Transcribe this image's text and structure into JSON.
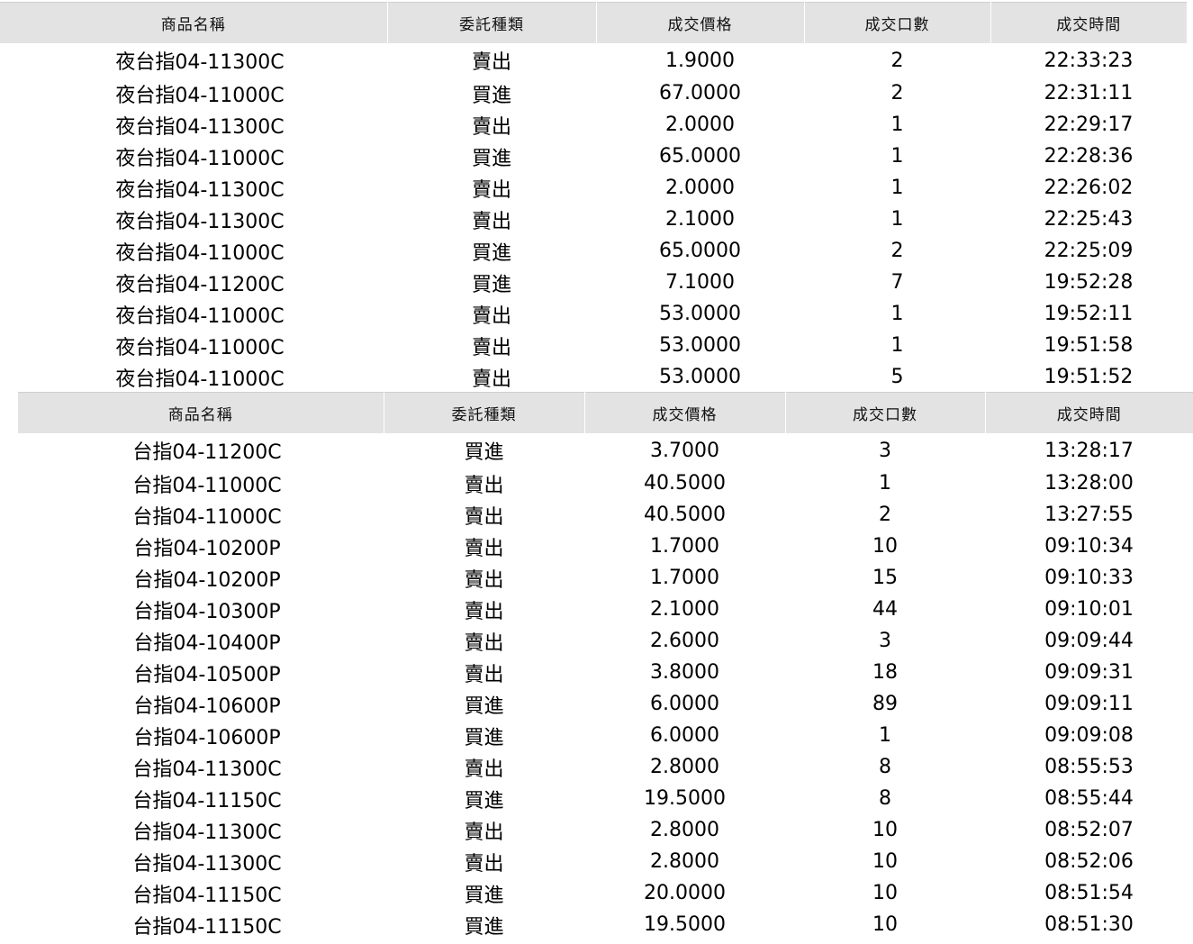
{
  "night_session": {
    "headers": [
      "商品名稱",
      "委託種類",
      "成交價格",
      "成交口數",
      "成交時間"
    ],
    "rows": [
      [
        "夜台指04-11300C",
        "賣出",
        "1.9000",
        "2",
        "22:33:23"
      ],
      [
        "夜台指04-11000C",
        "買進",
        "67.0000",
        "2",
        "22:31:11"
      ],
      [
        "夜台指04-11300C",
        "賣出",
        "2.0000",
        "1",
        "22:29:17"
      ],
      [
        "夜台指04-11000C",
        "買進",
        "65.0000",
        "1",
        "22:28:36"
      ],
      [
        "夜台指04-11300C",
        "賣出",
        "2.0000",
        "1",
        "22:26:02"
      ],
      [
        "夜台指04-11300C",
        "賣出",
        "2.1000",
        "1",
        "22:25:43"
      ],
      [
        "夜台指04-11000C",
        "買進",
        "65.0000",
        "2",
        "22:25:09"
      ],
      [
        "夜台指04-11200C",
        "買進",
        "7.1000",
        "7",
        "19:52:28"
      ],
      [
        "夜台指04-11000C",
        "賣出",
        "53.0000",
        "1",
        "19:52:11"
      ],
      [
        "夜台指04-11000C",
        "賣出",
        "53.0000",
        "1",
        "19:51:58"
      ],
      [
        "夜台指04-11000C",
        "賣出",
        "53.0000",
        "5",
        "19:51:52"
      ]
    ]
  },
  "day_session": {
    "headers": [
      "商品名稱",
      "委託種類",
      "成交價格",
      "成交口數",
      "成交時間"
    ],
    "rows": [
      [
        "台指04-11200C",
        "買進",
        "3.7000",
        "3",
        "13:28:17"
      ],
      [
        "台指04-11000C",
        "賣出",
        "40.5000",
        "1",
        "13:28:00"
      ],
      [
        "台指04-11000C",
        "賣出",
        "40.5000",
        "2",
        "13:27:55"
      ],
      [
        "台指04-10200P",
        "賣出",
        "1.7000",
        "10",
        "09:10:34"
      ],
      [
        "台指04-10200P",
        "賣出",
        "1.7000",
        "15",
        "09:10:33"
      ],
      [
        "台指04-10300P",
        "賣出",
        "2.1000",
        "44",
        "09:10:01"
      ],
      [
        "台指04-10400P",
        "賣出",
        "2.6000",
        "3",
        "09:09:44"
      ],
      [
        "台指04-10500P",
        "賣出",
        "3.8000",
        "18",
        "09:09:31"
      ],
      [
        "台指04-10600P",
        "買進",
        "6.0000",
        "89",
        "09:09:11"
      ],
      [
        "台指04-10600P",
        "買進",
        "6.0000",
        "1",
        "09:09:08"
      ],
      [
        "台指04-11300C",
        "賣出",
        "2.8000",
        "8",
        "08:55:53"
      ],
      [
        "台指04-11150C",
        "買進",
        "19.5000",
        "8",
        "08:55:44"
      ],
      [
        "台指04-11300C",
        "賣出",
        "2.8000",
        "10",
        "08:52:07"
      ],
      [
        "台指04-11300C",
        "賣出",
        "2.8000",
        "10",
        "08:52:06"
      ],
      [
        "台指04-11150C",
        "買進",
        "20.0000",
        "10",
        "08:51:54"
      ],
      [
        "台指04-11150C",
        "買進",
        "19.5000",
        "10",
        "08:51:30"
      ]
    ]
  },
  "colors": {
    "header_background": "#e3e3e3",
    "text": "#000000"
  }
}
